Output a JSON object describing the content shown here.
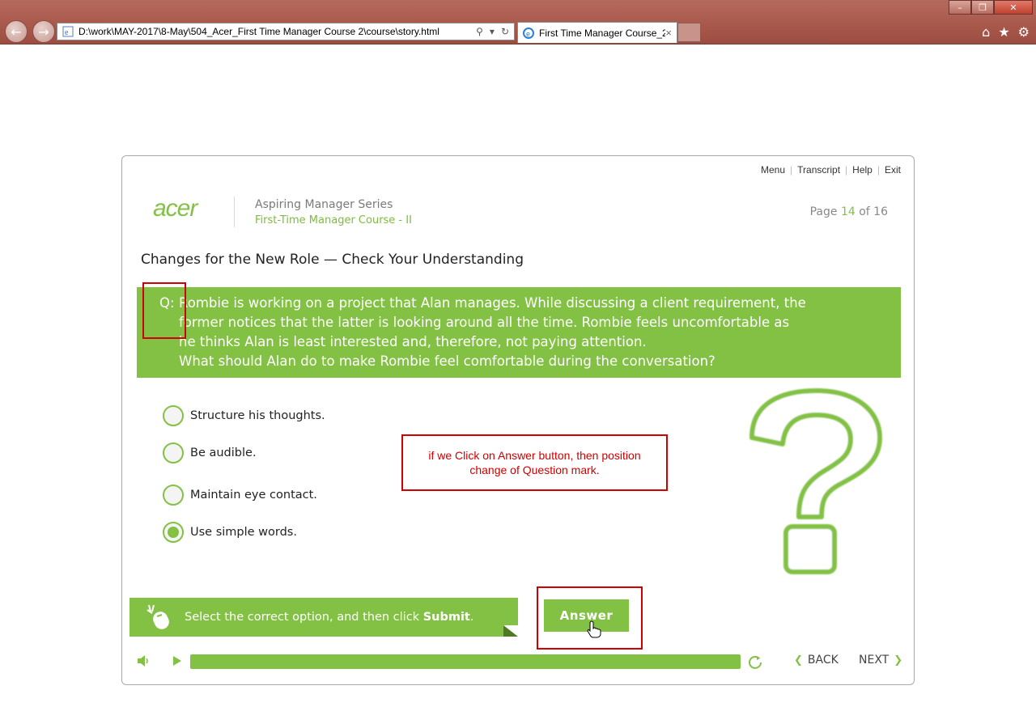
{
  "browser": {
    "address": "D:\\work\\MAY-2017\\8-May\\504_Acer_First Time Manager Course 2\\course\\story.html",
    "tab_title": "First Time Manager Course_2",
    "tab_close": "×"
  },
  "player": {
    "top_links": [
      "Menu",
      "Transcript",
      "Help",
      "Exit"
    ],
    "logo": "acer",
    "series_title": "Aspiring Manager Series",
    "course_title": "First-Time Manager Course - II",
    "page": {
      "prefix": "Page",
      "current": "14",
      "of": "of",
      "total": "16"
    },
    "section_title": "Changes for the New Role — Check Your Understanding",
    "question": {
      "prefix": "Q:",
      "lines": [
        "Rombie is working on a project that Alan manages. While discussing a client requirement, the",
        "former notices that the latter is looking around all the time. Rombie feels uncomfortable as",
        "he thinks Alan is least interested and, therefore, not paying attention.",
        "What should Alan do to make Rombie feel comfortable during the conversation?"
      ]
    },
    "options": [
      {
        "label": "Structure his thoughts.",
        "selected": false
      },
      {
        "label": "Be audible.",
        "selected": false
      },
      {
        "label": "Maintain eye contact.",
        "selected": false
      },
      {
        "label": "Use simple words.",
        "selected": true
      }
    ],
    "annotation": "if we Click on Answer button, then position change of Question mark.",
    "instruction": {
      "text": "Select the correct option, and then click",
      "bold": "Submit",
      "end": "."
    },
    "answer_button": "Answer",
    "nav": {
      "back": "BACK",
      "next": "NEXT"
    },
    "colors": {
      "accent": "#83c144",
      "annotation": "#d00000"
    }
  }
}
